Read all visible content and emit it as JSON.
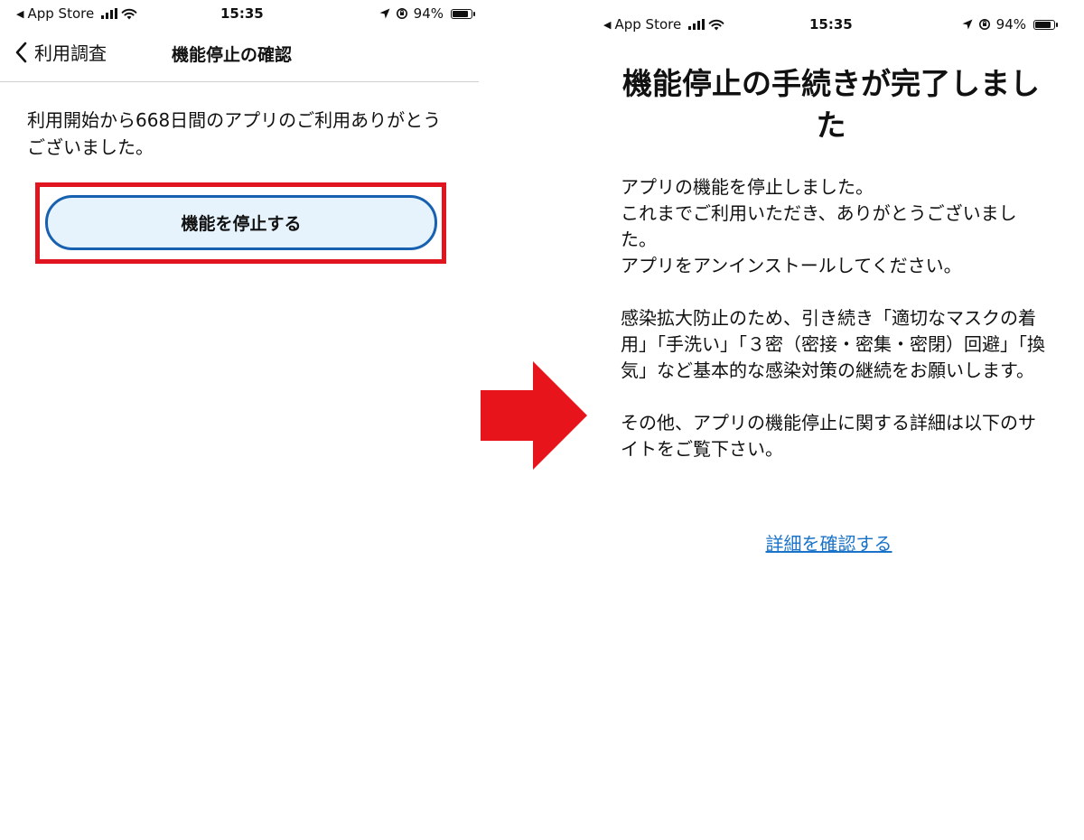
{
  "status_bar": {
    "back_app": "App Store",
    "time": "15:35",
    "battery_percent": "94%",
    "battery_level": 0.94,
    "signal_bars": 4
  },
  "left_screen": {
    "nav": {
      "back_label": "利用調査",
      "title": "機能停止の確認"
    },
    "message": "利用開始から668日間のアプリのご利用ありがとうございました。",
    "stop_button_label": "機能を停止する",
    "highlight_color": "#e0151f",
    "button_border_color": "#1761b0"
  },
  "arrow_color": "#e8141c",
  "right_screen": {
    "title": "機能停止の手続きが完了しました",
    "paragraphs": [
      "アプリの機能を停止しました。\nこれまでご利用いただき、ありがとうございました。\nアプリをアンインストールしてください。",
      "感染拡大防止のため、引き続き「適切なマスクの着用」「手洗い」「３密（密接・密集・密閉）回避」「換気」など基本的な感染対策の継続をお願いします。",
      "その他、アプリの機能停止に関する詳細は以下のサイトをご覧下さい。"
    ],
    "detail_link": "詳細を確認する",
    "link_color": "#1a73c8"
  }
}
